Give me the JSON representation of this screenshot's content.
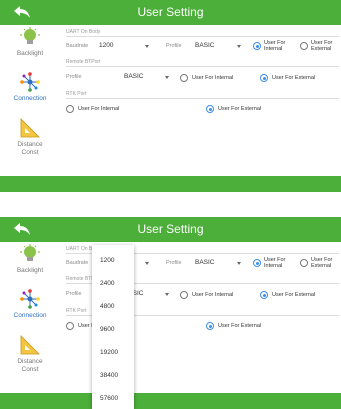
{
  "header": {
    "title": "User Setting"
  },
  "sidebar": {
    "backlight": "Backlight",
    "connection": "Connection",
    "distance_line1": "Distance",
    "distance_line2": "Const"
  },
  "sections": {
    "uart": "UART On Body",
    "remote": "Remote BTPort",
    "rtk": "RTK Port"
  },
  "uart": {
    "baudrate_label": "Baudrate",
    "baudrate_value": "1200",
    "profile_label": "Profile",
    "profile_value": "BASIC",
    "opt_internal": "User For Internal",
    "opt_external": "User For External",
    "opt_internal_l1": "User For",
    "opt_internal_l2": "Internal",
    "opt_external_l1": "User For",
    "opt_external_l2": "External",
    "selected": "internal"
  },
  "remote": {
    "profile_label": "Profile",
    "profile_value": "BASIC",
    "opt_internal": "User For Internal",
    "opt_external": "User For External",
    "selected": "external"
  },
  "rtk": {
    "opt_internal": "User For Internal",
    "opt_external": "User For External",
    "selected": "external"
  },
  "baudrate_dropdown": {
    "options": [
      "1200",
      "2400",
      "4800",
      "9600",
      "19200",
      "38400",
      "57600"
    ]
  },
  "colors": {
    "bar": "#4caf3a",
    "accent": "#3d8ee8",
    "active_label": "#2f6fc0"
  }
}
